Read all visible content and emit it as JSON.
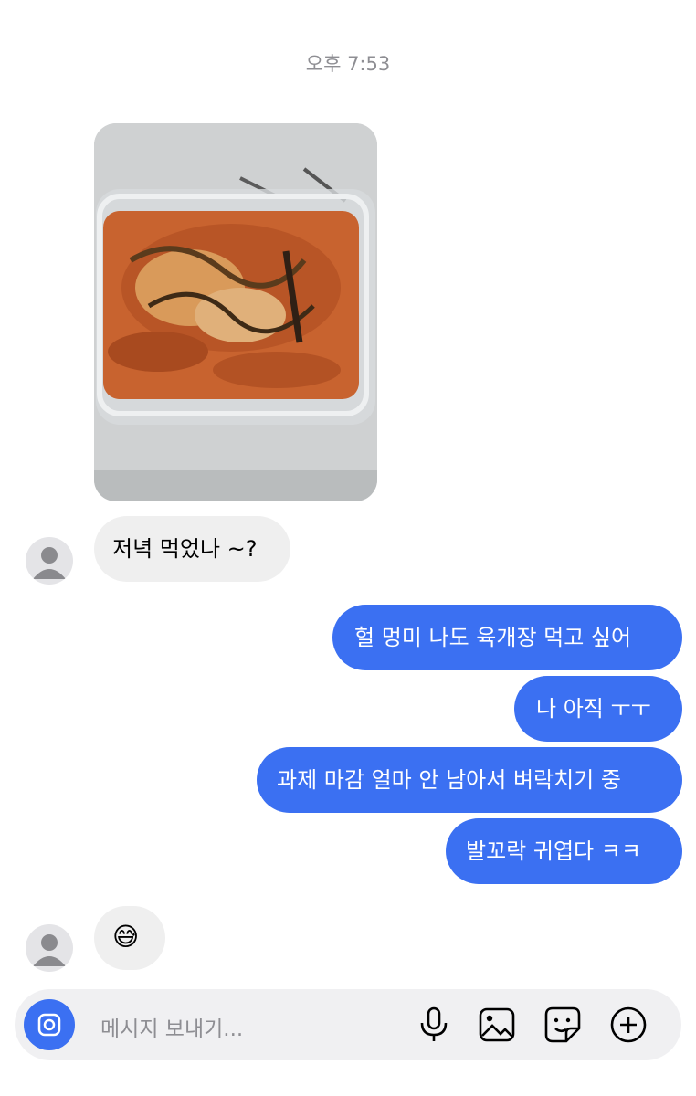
{
  "thread": {
    "timestamp": "오후 7:53"
  },
  "messages": [
    {
      "id": "photo",
      "sender": "them",
      "kind": "image"
    },
    {
      "id": "m1",
      "sender": "them",
      "text": "저녁 먹었나 ~?"
    },
    {
      "id": "m2",
      "sender": "me",
      "text": "헐 멍미 나도 육개장 먹고 싶어"
    },
    {
      "id": "m3",
      "sender": "me",
      "text": "나 아직 ㅜㅜ"
    },
    {
      "id": "m4",
      "sender": "me",
      "text": "과제 마감 얼마 안 남아서 벼락치기 중"
    },
    {
      "id": "m5",
      "sender": "me",
      "text": "발꼬락 귀엽다 ㅋㅋ"
    },
    {
      "id": "m6",
      "sender": "them",
      "text": "😅"
    }
  ],
  "composer": {
    "placeholder": "메시지 보내기...",
    "icons": [
      "camera-icon",
      "microphone-icon",
      "gallery-icon",
      "sticker-icon",
      "plus-icon"
    ]
  },
  "colors": {
    "outgoing_bubble": "#3b70f2",
    "incoming_bubble": "#efefef",
    "timestamp": "#8e8e93"
  }
}
